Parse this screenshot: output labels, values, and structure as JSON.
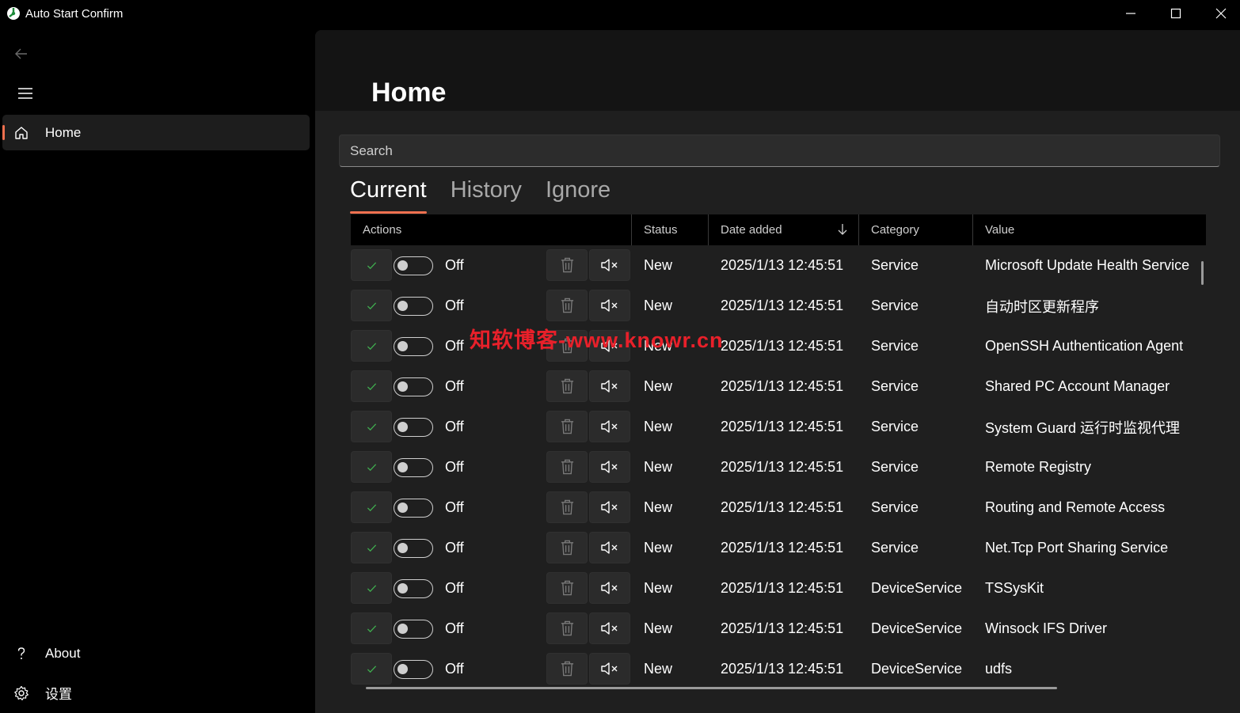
{
  "window": {
    "title": "Auto Start Confirm"
  },
  "nav": {
    "items": [
      {
        "label": "Home",
        "icon": "home-icon",
        "selected": true
      },
      {
        "label": "About",
        "icon": "question-icon"
      },
      {
        "label": "设置",
        "icon": "gear-icon"
      }
    ]
  },
  "page": {
    "title": "Home",
    "search_placeholder": "Search"
  },
  "tabs": [
    {
      "label": "Current",
      "active": true
    },
    {
      "label": "History"
    },
    {
      "label": "Ignore"
    }
  ],
  "grid": {
    "columns": [
      "Actions",
      "Status",
      "Date added",
      "Category",
      "Value"
    ],
    "sort_column": "Date added",
    "sort_direction": "descending",
    "rows": [
      {
        "toggle": "Off",
        "status": "New",
        "date": "2025/1/13 12:45:51",
        "category": "Service",
        "value": "Microsoft Update Health Service"
      },
      {
        "toggle": "Off",
        "status": "New",
        "date": "2025/1/13 12:45:51",
        "category": "Service",
        "value": "自动时区更新程序"
      },
      {
        "toggle": "Off",
        "status": "New",
        "date": "2025/1/13 12:45:51",
        "category": "Service",
        "value": "OpenSSH Authentication Agent"
      },
      {
        "toggle": "Off",
        "status": "New",
        "date": "2025/1/13 12:45:51",
        "category": "Service",
        "value": "Shared PC Account Manager"
      },
      {
        "toggle": "Off",
        "status": "New",
        "date": "2025/1/13 12:45:51",
        "category": "Service",
        "value": "System Guard 运行时监视代理"
      },
      {
        "toggle": "Off",
        "status": "New",
        "date": "2025/1/13 12:45:51",
        "category": "Service",
        "value": "Remote Registry"
      },
      {
        "toggle": "Off",
        "status": "New",
        "date": "2025/1/13 12:45:51",
        "category": "Service",
        "value": "Routing and Remote Access"
      },
      {
        "toggle": "Off",
        "status": "New",
        "date": "2025/1/13 12:45:51",
        "category": "Service",
        "value": "Net.Tcp Port Sharing Service"
      },
      {
        "toggle": "Off",
        "status": "New",
        "date": "2025/1/13 12:45:51",
        "category": "DeviceService",
        "value": "TSSysKit"
      },
      {
        "toggle": "Off",
        "status": "New",
        "date": "2025/1/13 12:45:51",
        "category": "DeviceService",
        "value": "Winsock IFS Driver"
      },
      {
        "toggle": "Off",
        "status": "New",
        "date": "2025/1/13 12:45:51",
        "category": "DeviceService",
        "value": "udfs"
      }
    ]
  },
  "watermark": "知软博客-www.knowr.cn",
  "colors": {
    "accent": "#f0704f",
    "confirm_check": "#3fae4f",
    "content_bg": "#1f1f1f",
    "header_bg": "#141414"
  }
}
